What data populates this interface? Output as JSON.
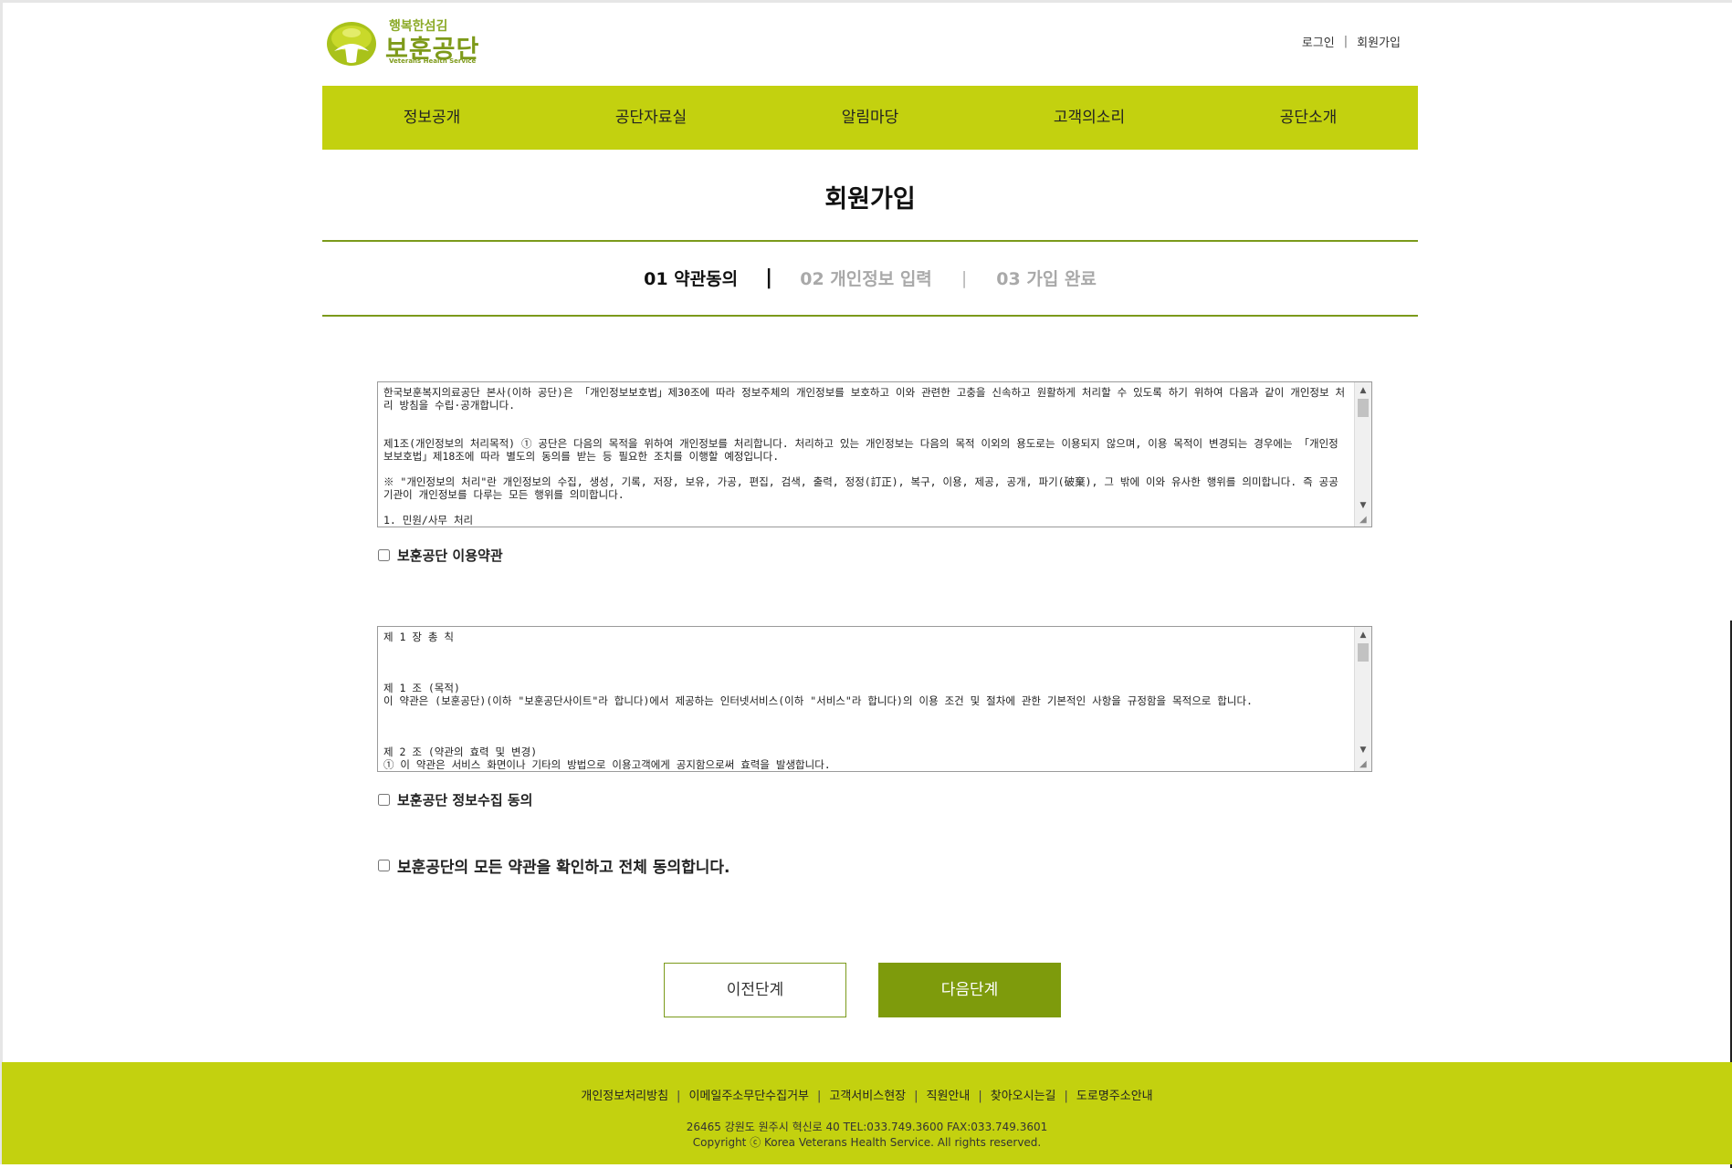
{
  "header": {
    "logo_small": "행복한섬김",
    "logo_main": "보훈공단",
    "logo_en": "Veterans Health Service",
    "util_links": [
      "로그인",
      "회원가입"
    ]
  },
  "gnb": [
    "정보공개",
    "공단자료실",
    "알림마당",
    "고객의소리",
    "공단소개"
  ],
  "page_title": "회원가입",
  "steps": {
    "step1": "01 약관동의",
    "step2": "02 개인정보 입력",
    "step3": "03 가입 완료",
    "sep": "|"
  },
  "terms": {
    "privacy_text": "한국보훈복지의료공단 본사(이하 공단)은 「개인정보보호법」제30조에 따라 정보주체의 개인정보를 보호하고 이와 관련한 고충을 신속하고 원활하게 처리할 수 있도록 하기 위하여 다음과 같이 개인정보 처리 방침을 수립·공개합니다.\n\n\n제1조(개인정보의 처리목적) ① 공단은 다음의 목적을 위하여 개인정보를 처리합니다. 처리하고 있는 개인정보는 다음의 목적 이외의 용도로는 이용되지 않으며, 이용 목적이 변경되는 경우에는 「개인정보보호법」제18조에 따라 별도의 동의를 받는 등 필요한 조치를 이행할 예정입니다.\n\n※ \"개인정보의 처리\"란 개인정보의 수집, 생성, 기록, 저장, 보유, 가공, 편집, 검색, 출력, 정정(訂正), 복구, 이용, 제공, 공개, 파기(破棄), 그 밖에 이와 유사한 행위를 의미합니다. 즉 공공기관이 개인정보를 다루는 모든 행위를 의미합니다.\n\n1. 민원/사무 처리",
    "privacy_check_label": "보훈공단 이용약관",
    "usage_text": "제 1 장 총 칙\n\n\n\n제 1 조 (목적)\n이 약관은 (보훈공단)(이하 \"보훈공단사이트\"라 합니다)에서 제공하는 인터넷서비스(이하 \"서비스\"라 합니다)의 이용 조건 및 절차에 관한 기본적인 사항을 규정함을 목적으로 합니다.\n\n\n\n제 2 조 (약관의 효력 및 변경)\n① 이 약관은 서비스 화면이나 기타의 방법으로 이용고객에게 공지함으로써 효력을 발생합니다.",
    "usage_check_label": "보훈공단 정보수집 동의",
    "all_agree_label": "보훈공단의 모든 약관을 확인하고 전체 동의합니다."
  },
  "buttons": {
    "prev": "이전단계",
    "next": "다음단계"
  },
  "footer": {
    "links": [
      "개인정보처리방침",
      "이메일주소무단수집거부",
      "고객서비스현장",
      "직원안내",
      "찾아오시는길",
      "도로명주소안내"
    ],
    "address": "26465 강원도 원주시 혁신로 40 TEL:033.749.3600 FAX:033.749.3601",
    "copyright": "Copyright ⓒ Korea Veterans Health Service. All rights reserved."
  },
  "colors": {
    "brand_lime": "#c3d10f",
    "brand_green": "#7e9b0c"
  },
  "icons": {
    "scroll_up": "▲",
    "scroll_down": "▼",
    "resize": "◢"
  }
}
